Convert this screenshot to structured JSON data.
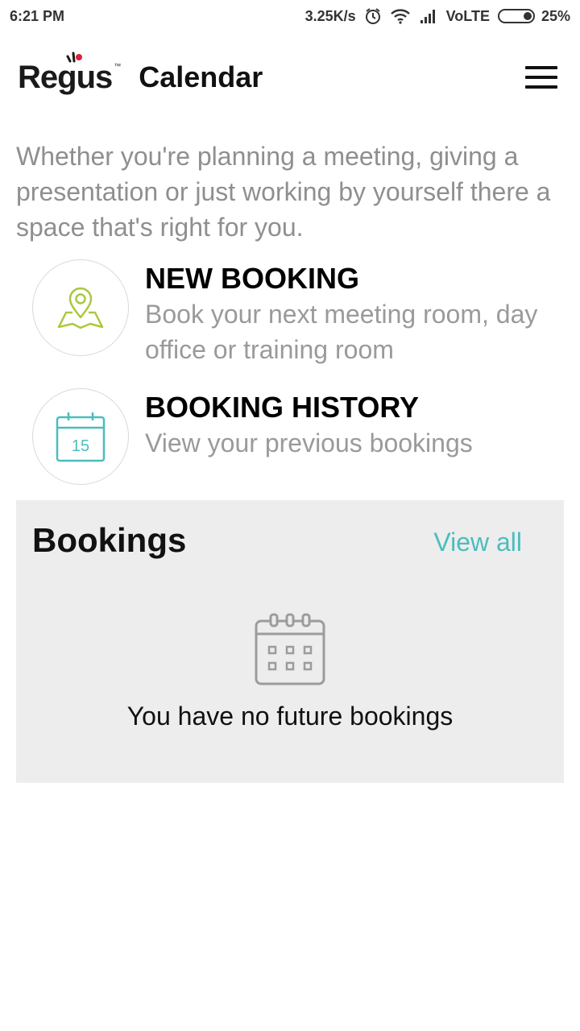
{
  "status_bar": {
    "time": "6:21 PM",
    "speed": "3.25K/s",
    "network": "VoLTE",
    "battery": "25%"
  },
  "header": {
    "logo_text": "Regus",
    "logo_tm": "™",
    "title": "Calendar"
  },
  "intro": "Whether you're planning a meeting, giving a presentation or just working by yourself there a space that's right for you.",
  "actions": [
    {
      "title": "NEW BOOKING",
      "description": "Book your next meeting room, day office or training room",
      "icon": "map-pin-icon"
    },
    {
      "title": "BOOKING HISTORY",
      "description": "View your previous bookings",
      "icon": "calendar-icon",
      "icon_day": "15"
    }
  ],
  "bookings": {
    "title": "Bookings",
    "view_all": "View all",
    "empty_message": "You have no future bookings"
  },
  "colors": {
    "accent_teal": "#4cbdbd",
    "pin_green": "#a9c93d",
    "logo_red": "#d6243a"
  }
}
